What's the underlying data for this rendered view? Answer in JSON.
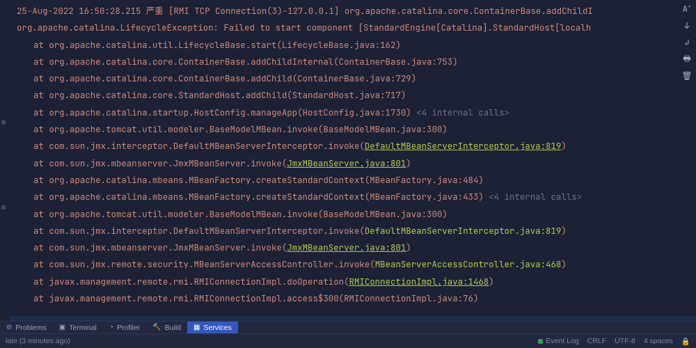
{
  "header": {
    "timestamp": "25-Aug-2022 16:50:28.215",
    "level": "严重",
    "thread": "[RMI TCP Connection(3)-127.0.0.1]",
    "logger": "org.apache.catalina.core.ContainerBase.addChildI"
  },
  "exception": "org.apache.catalina.LifecycleException: Failed to start component [StandardEngine[Catalina].StandardHost[localh",
  "frames": [
    {
      "method": "org.apache.catalina.util.LifecycleBase.start",
      "loc": "LifecycleBase.java:162"
    },
    {
      "method": "org.apache.catalina.core.ContainerBase.addChildInternal",
      "loc": "ContainerBase.java:753"
    },
    {
      "method": "org.apache.catalina.core.ContainerBase.addChild",
      "loc": "ContainerBase.java:729"
    },
    {
      "method": "org.apache.catalina.core.StandardHost.addChild",
      "loc": "StandardHost.java:717"
    },
    {
      "method": "org.apache.catalina.startup.HostConfig.manageApp",
      "loc": "HostConfig.java:1730",
      "note": "<4 internal calls>"
    },
    {
      "method": "org.apache.tomcat.util.modeler.BaseModelMBean.invoke",
      "loc": "BaseModelMBean.java:300"
    },
    {
      "method": "com.sun.jmx.interceptor.DefaultMBeanServerInterceptor.invoke",
      "loc": "DefaultMBeanServerInterceptor.java:819",
      "link": true
    },
    {
      "method": "com.sun.jmx.mbeanserver.JmxMBeanServer.invoke",
      "loc": "JmxMBeanServer.java:801",
      "link": true
    },
    {
      "method": "org.apache.catalina.mbeans.MBeanFactory.createStandardContext",
      "loc": "MBeanFactory.java:484"
    },
    {
      "method": "org.apache.catalina.mbeans.MBeanFactory.createStandardContext",
      "loc": "MBeanFactory.java:433",
      "note": "<4 internal calls>"
    },
    {
      "method": "org.apache.tomcat.util.modeler.BaseModelMBean.invoke",
      "loc": "BaseModelMBean.java:300"
    },
    {
      "method": "com.sun.jmx.interceptor.DefaultMBeanServerInterceptor.invoke",
      "loc": "DefaultMBeanServerInterceptor.java:819",
      "link": true,
      "link_style": "plain"
    },
    {
      "method": "com.sun.jmx.mbeanserver.JmxMBeanServer.invoke",
      "loc": "JmxMBeanServer.java:801",
      "link": true
    },
    {
      "method": "com.sun.jmx.remote.security.MBeanServerAccessController.invoke",
      "loc": "MBeanServerAccessController.java:468",
      "link": true,
      "link_style": "plain"
    },
    {
      "method": "javax.management.remote.rmi.RMIConnectionImpl.doOperation",
      "loc": "RMIConnectionImpl.java:1468",
      "link": true
    },
    {
      "method": "javax.management.remote.rmi.RMIConnectionImpl.access$300",
      "loc": "RMIConnectionImpl.java:76",
      "cut": true
    }
  ],
  "tabs": [
    {
      "label": "Problems"
    },
    {
      "label": "Terminal"
    },
    {
      "label": "Profiler"
    },
    {
      "label": "Build"
    },
    {
      "label": "Services"
    }
  ],
  "status": {
    "left": "late (3 minutes ago)",
    "event_log": "Event Log",
    "line_sep": "CRLF",
    "encoding": "UTF-8",
    "indent": "4 spaces"
  }
}
